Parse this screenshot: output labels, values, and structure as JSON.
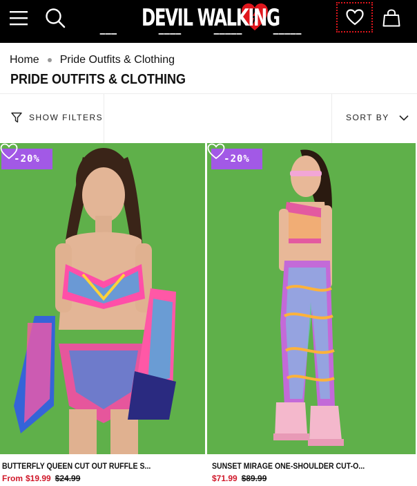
{
  "header": {
    "logo_text": "DEVIL WALKING",
    "icons": {
      "menu": "hamburger-menu-icon",
      "search": "search-icon",
      "wishlist": "heart-outline-icon",
      "cart": "shopping-bag-icon",
      "logo_mark": "red-heart-logo-icon"
    }
  },
  "breadcrumb": {
    "home": "Home",
    "current": "Pride Outfits & Clothing"
  },
  "page_title": "PRIDE OUTFITS & CLOTHING",
  "filters": {
    "show_filters_label": "SHOW FILTERS",
    "sort_by_label": "SORT BY"
  },
  "colors": {
    "header_bg": "#000000",
    "badge": "#a259e6",
    "sale_price": "#d0182a",
    "product_bg": "#5fb04a",
    "logo_accent": "#e0161c"
  },
  "products": [
    {
      "badge": "-20%",
      "name": "BUTTERFLY QUEEN CUT OUT RUFFLE S...",
      "price_prefix": "From",
      "price_now": "$19.99",
      "price_was": "$24.99"
    },
    {
      "badge": "-20%",
      "name": "SUNSET MIRAGE ONE-SHOULDER CUT-O...",
      "price_now": "$71.99",
      "price_was": "$89.99"
    }
  ]
}
